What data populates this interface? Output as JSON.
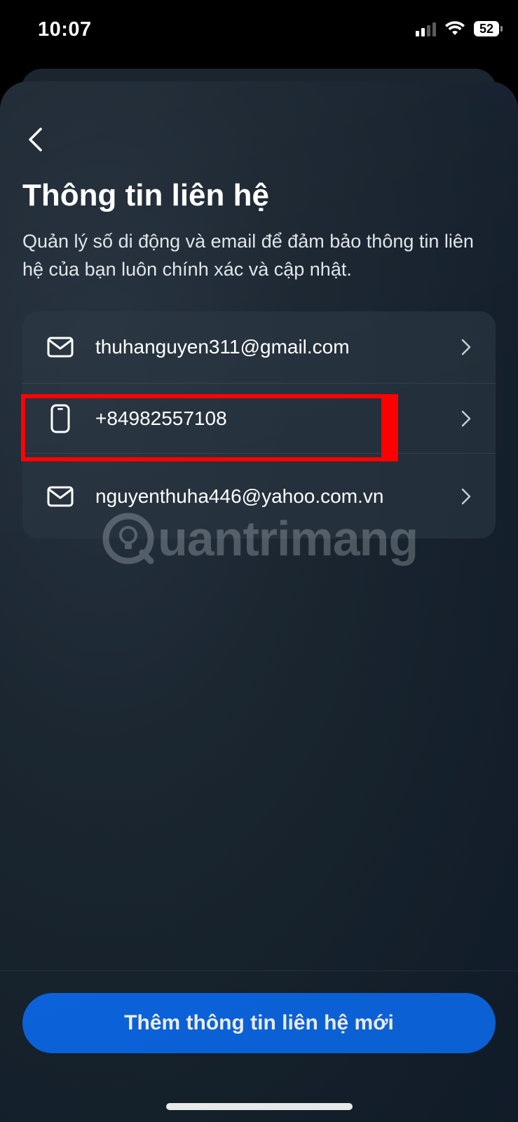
{
  "status_bar": {
    "time": "10:07",
    "battery": "52",
    "icons": [
      "signal-icon",
      "wifi-icon",
      "battery-icon"
    ]
  },
  "header": {
    "back_icon": "chevron-left-icon",
    "title": "Thông tin liên hệ",
    "subtitle": "Quản lý số di động và email để đảm bảo thông tin liên hệ của bạn luôn chính xác và cập nhật."
  },
  "contacts": [
    {
      "type": "email",
      "icon": "mail-icon",
      "value": "thuhanguyen311@gmail.com"
    },
    {
      "type": "phone",
      "icon": "phone-icon",
      "value": "+84982557108"
    },
    {
      "type": "email",
      "icon": "mail-icon",
      "value": "nguyenthuha446@yahoo.com.vn"
    }
  ],
  "watermark": "uantrimang",
  "footer": {
    "add_button": "Thêm thông tin liên hệ mới"
  },
  "colors": {
    "accent": "#0a66e8",
    "highlight": "#ff0000",
    "background": "#15202c"
  }
}
